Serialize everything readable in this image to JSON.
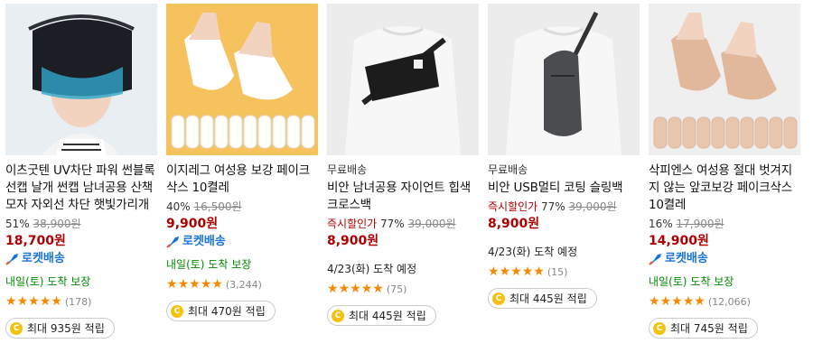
{
  "products": [
    {
      "tag": "",
      "title": "이츠굿텐 UV차단 파워 썬블록 선캡 날개 썬캡 남녀공용 산책모자 자외선 차단 햇빛가리개",
      "instant_label": "",
      "discount": "51%",
      "original_price": "38,900원",
      "price": "18,700원",
      "rocket": "로켓배송",
      "delivery": "내일(토) 도착 보장",
      "review_count": "(178)",
      "points": "최대 935원 적립"
    },
    {
      "tag": "",
      "title": "이지레그 여성용 보강 페이크삭스 10켤레",
      "instant_label": "",
      "discount": "40%",
      "original_price": "16,500원",
      "price": "9,900원",
      "rocket": "로켓배송",
      "delivery": "내일(토) 도착 보장",
      "review_count": "(3,244)",
      "points": "최대 470원 적립"
    },
    {
      "tag": "무료배송",
      "title": "비안 남녀공용 자이언트 힙색 크로스백",
      "instant_label": "즉시할인가",
      "discount": "77%",
      "original_price": "39,000원",
      "price": "8,900원",
      "rocket": "",
      "delivery": "4/23(화) 도착 예정",
      "review_count": "(75)",
      "points": "최대 445원 적립"
    },
    {
      "tag": "무료배송",
      "title": "비안 USB멀티 코팅 슬링백",
      "instant_label": "즉시할인가",
      "discount": "77%",
      "original_price": "39,000원",
      "price": "8,900원",
      "rocket": "",
      "delivery": "4/23(화) 도착 예정",
      "review_count": "(15)",
      "points": "최대 445원 적립"
    },
    {
      "tag": "",
      "title": "삭피엔스 여성용 절대 벗겨지지 않는 앞코보강 페이크삭스 10켤레",
      "instant_label": "",
      "discount": "16%",
      "original_price": "17,900원",
      "price": "14,900원",
      "rocket": "로켓배송",
      "delivery": "내일(토) 도착 보장",
      "review_count": "(12,066)",
      "points": "최대 745원 적립"
    }
  ],
  "icons": {
    "star": "★",
    "coin": "C",
    "rocket": "rocket-icon"
  },
  "colors": {
    "price": "#ae0000",
    "rocket": "#1a73d9",
    "delivery": "#008c00",
    "star": "#f58a02"
  }
}
